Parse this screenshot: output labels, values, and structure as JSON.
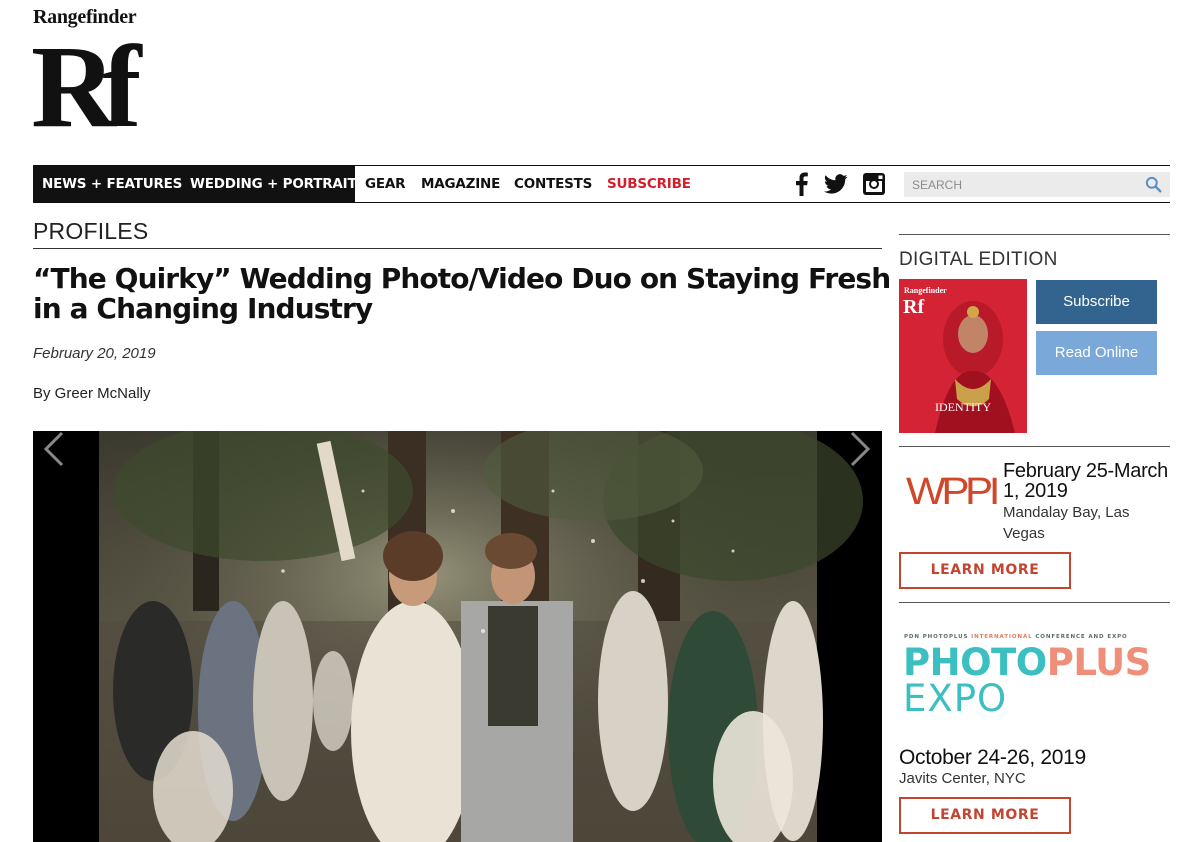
{
  "brand": {
    "wordmark": "Rangefinder",
    "monogram": "Rf"
  },
  "nav": {
    "items": [
      {
        "label": "NEWS + FEATURES"
      },
      {
        "label": "WEDDING + PORTRAIT"
      },
      {
        "label": "GEAR"
      },
      {
        "label": "MAGAZINE"
      },
      {
        "label": "CONTESTS"
      },
      {
        "label": "SUBSCRIBE"
      }
    ],
    "social": [
      "facebook-icon",
      "twitter-icon",
      "instagram-icon"
    ],
    "search_placeholder": "SEARCH"
  },
  "article": {
    "section": "PROFILES",
    "title": "“The Quirky” Wedding Photo/Video Duo on Staying Fresh in a Changing Industry",
    "date": "February 20, 2019",
    "byline": "By Greer McNally"
  },
  "sidebar": {
    "digital": {
      "title": "DIGITAL EDITION",
      "cover_wordmark": "Rangefinder",
      "cover_monogram": "Rf",
      "cover_title": "IDENTITY",
      "subscribe": "Subscribe",
      "read_online": "Read Online"
    },
    "wppi": {
      "logo": "WPPI",
      "dates": "February 25-March 1, 2019",
      "venue": "Mandalay Bay, Las Vegas",
      "cta": "LEARN MORE"
    },
    "photoplus": {
      "tagline_left": "PDN PHOTOPLUS",
      "tagline_mid": "INTERNATIONAL",
      "tagline_right": "CONFERENCE AND EXPO",
      "logo_a": "PHOTO",
      "logo_b": "PLUS",
      "logo_c": "EXPO",
      "dates": "October 24-26, 2019",
      "venue": "Javits Center, NYC",
      "cta": "LEARN MORE"
    }
  },
  "colors": {
    "nav_dark": "#111111",
    "subscribe_red": "#d0202e",
    "button_blue": "#33648f",
    "button_light_blue": "#7aa8d8",
    "ad_orange": "#c24530",
    "teal": "#3bbfc0"
  }
}
